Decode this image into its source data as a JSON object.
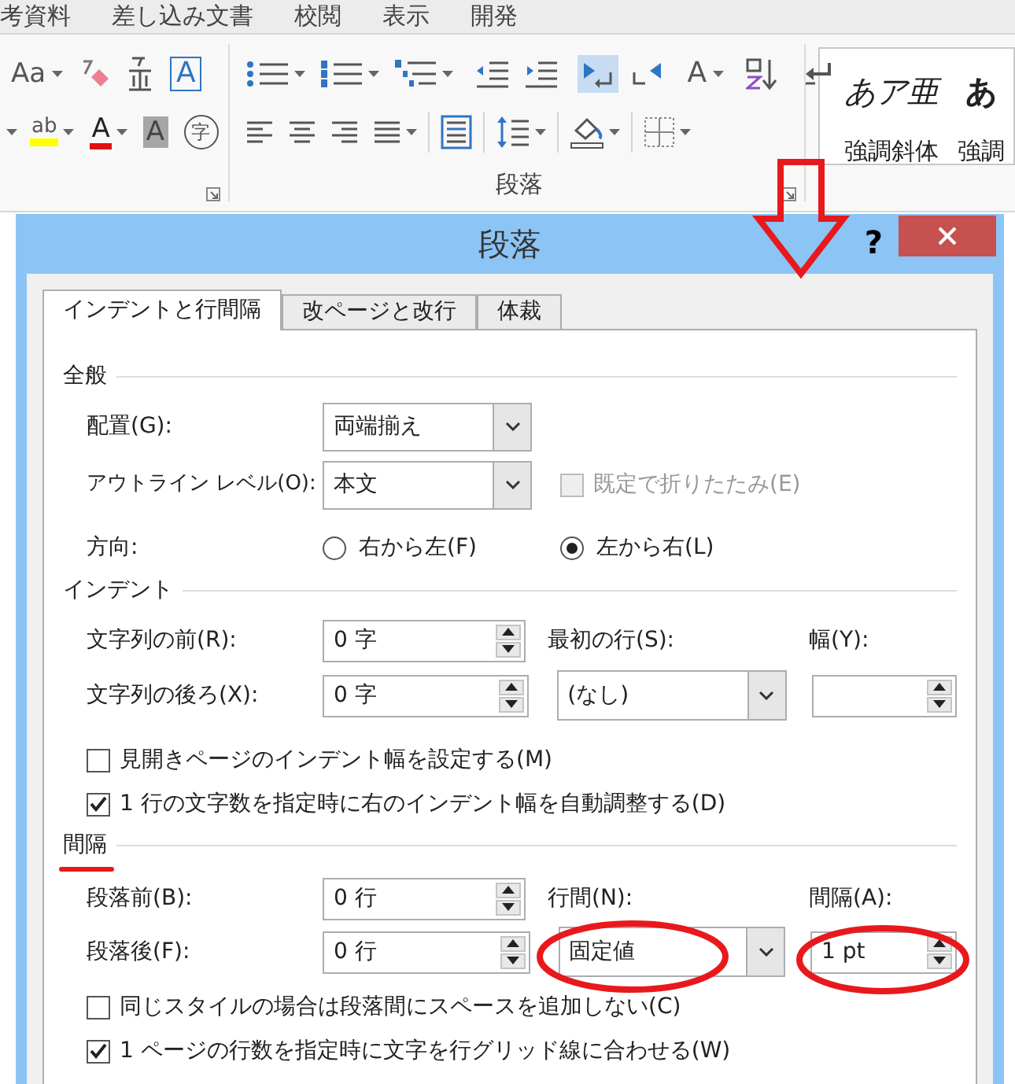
{
  "ribbon": {
    "tabs": [
      "考資料",
      "差し込み文書",
      "校閲",
      "表示",
      "開発"
    ],
    "font_tools": [
      [
        {
          "kind": "case",
          "glyph": "Aa"
        },
        {
          "kind": "eraser"
        },
        {
          "kind": "ruby"
        },
        {
          "kind": "boxed",
          "glyph": "A"
        }
      ],
      [
        {
          "kind": "caret"
        },
        {
          "kind": "highlight",
          "glyph": "ab"
        },
        {
          "kind": "color",
          "glyph": "A"
        },
        {
          "kind": "shaded",
          "glyph": "A"
        },
        {
          "kind": "enclosed",
          "glyph": "字"
        }
      ]
    ],
    "paragraph_tools": [
      [
        {
          "kind": "bullets",
          "selected": false
        },
        {
          "kind": "numbering",
          "selected": false
        },
        {
          "kind": "multilevel",
          "selected": false
        },
        {
          "kind": "outdent",
          "selected": false
        },
        {
          "kind": "indent",
          "selected": false
        },
        {
          "kind": "ltr",
          "selected": true
        },
        {
          "kind": "rtl",
          "selected": false
        },
        {
          "kind": "expand",
          "glyph": "A",
          "selected": false
        },
        {
          "kind": "sort",
          "selected": false
        },
        {
          "kind": "marks",
          "selected": false
        }
      ],
      [
        {
          "kind": "left",
          "selected": false
        },
        {
          "kind": "center",
          "selected": false
        },
        {
          "kind": "right",
          "selected": false
        },
        {
          "kind": "justify",
          "selected": false
        },
        {
          "kind": "distributed",
          "selected": false
        },
        {
          "kind": "spacing",
          "selected": false
        },
        {
          "kind": "shading",
          "selected": false
        },
        {
          "kind": "borders",
          "selected": false
        }
      ]
    ],
    "group_label": "段落",
    "styles": [
      {
        "sample": "あア亜",
        "name": "強調斜体",
        "kind": "italic"
      },
      {
        "sample": "あ",
        "name": "強調",
        "kind": "bold"
      }
    ]
  },
  "dialog": {
    "title": "段落",
    "help": "?",
    "tabs": [
      {
        "label": "インデントと行間隔",
        "selected": true
      },
      {
        "label": "改ページと改行",
        "selected": false
      },
      {
        "label": "体裁",
        "selected": false
      }
    ],
    "general": {
      "heading": "全般",
      "alignment": {
        "label": "配置(G):",
        "value": "両端揃え"
      },
      "outline_level": {
        "label": "アウトライン レベル(O):",
        "value": "本文"
      },
      "collapse": {
        "label": "既定で折りたたみ(E)",
        "checked": false,
        "disabled": true
      },
      "direction": {
        "label": "方向:",
        "options": [
          {
            "label": "右から左(F)",
            "selected": false
          },
          {
            "label": "左から右(L)",
            "selected": true
          }
        ]
      }
    },
    "indent": {
      "heading": "インデント",
      "before": {
        "label": "文字列の前(R):",
        "value": "0 字"
      },
      "after": {
        "label": "文字列の後ろ(X):",
        "value": "0 字"
      },
      "first_line": {
        "label": "最初の行(S):",
        "value": "(なし)"
      },
      "width": {
        "label": "幅(Y):"
      },
      "checkboxes": [
        {
          "label": "見開きページのインデント幅を設定する(M)",
          "checked": false
        },
        {
          "label": "1 行の文字数を指定時に右のインデント幅を自動調整する(D)",
          "checked": true
        }
      ]
    },
    "spacing": {
      "heading": "間隔",
      "before": {
        "label": "段落前(B):",
        "value": "0 行"
      },
      "after": {
        "label": "段落後(F):",
        "value": "0 行"
      },
      "line_spacing": {
        "label": "行間(N):",
        "value": "固定値"
      },
      "at": {
        "label": "間隔(A):",
        "value": "1 pt"
      },
      "checkboxes": [
        {
          "label": "同じスタイルの場合は段落間にスペースを追加しない(C)",
          "checked": false
        },
        {
          "label": "1 ページの行数を指定時に文字を行グリッド線に合わせる(W)",
          "checked": true
        }
      ]
    }
  }
}
